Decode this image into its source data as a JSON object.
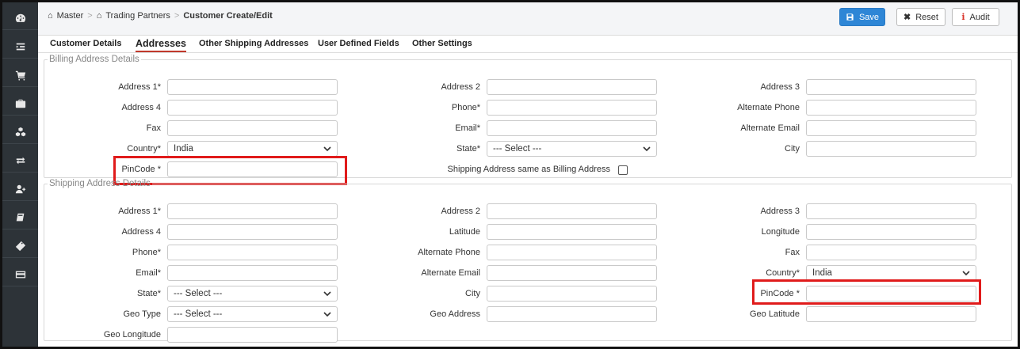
{
  "breadcrumb": {
    "items": [
      "Master",
      "Trading Partners"
    ],
    "current": "Customer Create/Edit"
  },
  "toolbar": {
    "save_label": "Save",
    "reset_label": "Reset",
    "audit_label": "Audit"
  },
  "tabs": [
    {
      "label": "Customer Details"
    },
    {
      "label": "Addresses"
    },
    {
      "label": "Other Shipping Addresses"
    },
    {
      "label": "User Defined Fields"
    },
    {
      "label": "Other Settings"
    }
  ],
  "active_tab": "Addresses",
  "billing": {
    "title": "Billing Address Details",
    "address1": "Address 1*",
    "address2": "Address 2",
    "address3": "Address 3",
    "address4": "Address 4",
    "phone": "Phone*",
    "alt_phone": "Alternate Phone",
    "fax": "Fax",
    "email": "Email*",
    "alt_email": "Alternate Email",
    "country": "Country*",
    "country_value": "India",
    "state": "State*",
    "state_value": "--- Select ---",
    "city": "City",
    "pincode": "PinCode *",
    "same_as_billing": "Shipping Address same as Billing Address"
  },
  "shipping": {
    "title": "Shipping Address Details",
    "address1": "Address 1*",
    "address2": "Address 2",
    "address3": "Address 3",
    "address4": "Address 4",
    "latitude": "Latitude",
    "longitude": "Longitude",
    "phone": "Phone*",
    "alt_phone": "Alternate Phone",
    "fax": "Fax",
    "email": "Email*",
    "alt_email": "Alternate Email",
    "country": "Country*",
    "country_value": "India",
    "state": "State*",
    "state_value": "--- Select ---",
    "city": "City",
    "pincode": "PinCode *",
    "geo_type": "Geo Type",
    "geo_type_value": "--- Select ---",
    "geo_address": "Geo Address",
    "geo_latitude": "Geo Latitude",
    "geo_longitude": "Geo Longitude"
  },
  "colors": {
    "sidebar": "#2d3338",
    "primary": "#2e86d6",
    "highlight": "#e01b1b",
    "active_tab_underline": "#c0392b"
  },
  "sidebar_icons": [
    "dashboard-icon",
    "menu-indent-icon",
    "cart-icon",
    "briefcase-icon",
    "cubes-icon",
    "exchange-icon",
    "user-plus-icon",
    "book-icon",
    "tag-icon",
    "card-icon"
  ]
}
